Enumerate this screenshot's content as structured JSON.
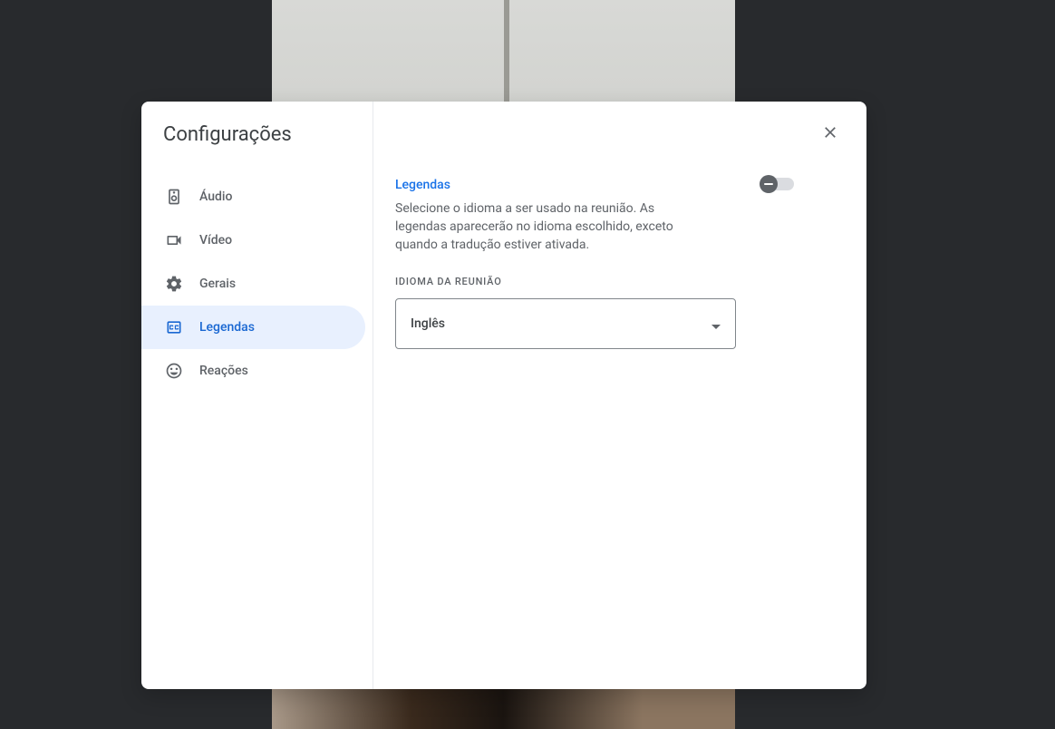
{
  "modal": {
    "title": "Configurações"
  },
  "sidebar": {
    "items": [
      {
        "label": "Áudio"
      },
      {
        "label": "Vídeo"
      },
      {
        "label": "Gerais"
      },
      {
        "label": "Legendas"
      },
      {
        "label": "Reações"
      }
    ]
  },
  "captions": {
    "title": "Legendas",
    "description": "Selecione o idioma a ser usado na reunião. As legendas aparecerão no idioma escolhido, exceto quando a tradução estiver ativada.",
    "toggle_on": false,
    "language_label": "IDIOMA DA REUNIÃO",
    "language_value": "Inglês"
  }
}
